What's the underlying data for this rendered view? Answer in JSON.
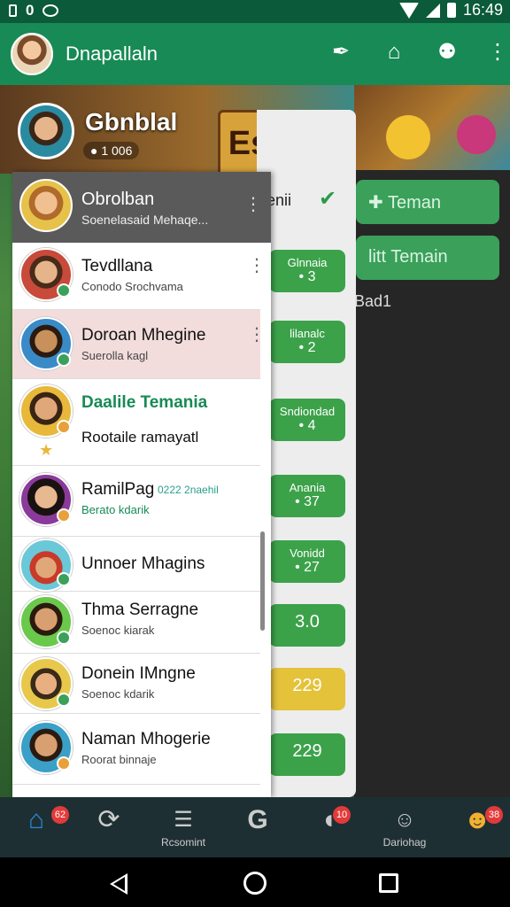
{
  "status_bar": {
    "left_icons": [
      "sim-icon",
      "n-icon",
      "cloud-icon"
    ],
    "left_text": "0",
    "time": "16:49"
  },
  "app_bar": {
    "title": "Dnapallaln",
    "icons": [
      "feather-icon",
      "bell-icon",
      "search-icon",
      "more-vert-icon"
    ]
  },
  "profile": {
    "name": "Gbnblal",
    "sub": "● 1 006",
    "game_sign": "Es"
  },
  "middle_panel": {
    "header": "ıenii",
    "buttons": [
      {
        "line1": "Glnnaia",
        "line2": "• 3"
      },
      {
        "line1": "lilanalc",
        "line2": "• 2"
      },
      {
        "line1": "Sndiondad",
        "line2": "• 4"
      },
      {
        "line1": "Anania",
        "line2": "• 37"
      },
      {
        "line1": "Vonidd",
        "line2": "• 27"
      },
      {
        "line1": "3.0",
        "line2": ""
      },
      {
        "line1": "229",
        "line2": ""
      },
      {
        "line1": "229",
        "line2": ""
      }
    ]
  },
  "right_panel": {
    "teman_button": "Teman",
    "tambah_button": "litt Temain",
    "label": "Bad1"
  },
  "friends": {
    "header": {
      "name": "Obrolban",
      "sub": "Soenelasaid Mehaqe..."
    },
    "rows": [
      {
        "name": "Tevdllana",
        "sub": "Conodo Srochvama"
      },
      {
        "name": "Doroan Mhegine",
        "sub": "Suerolla kagl"
      },
      {
        "name": "Daalile Temania",
        "sub": "Rootaile ramayatl"
      },
      {
        "name": "RamilPag",
        "tag": "0222 2naehil",
        "sub": "Berato kdarik"
      },
      {
        "name": "Unnoer Mhagins",
        "sub": ""
      },
      {
        "name": "Thma Serragne",
        "sub": "Soenoc kiarak"
      },
      {
        "name": "Donein IMngne",
        "sub": "Soenoc kdarik"
      },
      {
        "name": "Naman Mhogerie",
        "sub": "Roorat binnaje"
      }
    ]
  },
  "bottom_nav": [
    {
      "icon": "home-icon",
      "label": "",
      "badge": "62"
    },
    {
      "icon": "refresh-icon",
      "label": "",
      "badge": ""
    },
    {
      "icon": "notepad-icon",
      "label": "Rcsomint",
      "badge": ""
    },
    {
      "icon": "g-icon",
      "label": "",
      "badge": ""
    },
    {
      "icon": "chat-icon",
      "label": "",
      "badge": "10"
    },
    {
      "icon": "person-icon",
      "label": "Dariohag",
      "badge": ""
    },
    {
      "icon": "emoji-icon",
      "label": "",
      "badge": "38"
    }
  ],
  "colors": {
    "status_bar": "#0b5a3a",
    "app_bar": "#178a55",
    "accent_green": "#3ca24a",
    "highlight_row": "#f3dcdc",
    "bottom_nav": "#1e2f33"
  }
}
